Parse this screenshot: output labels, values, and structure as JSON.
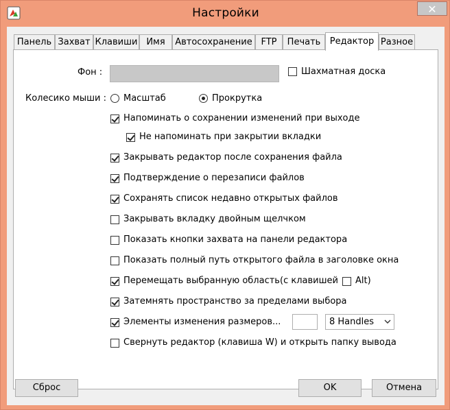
{
  "window": {
    "title": "Настройки",
    "close_glyph": "✕",
    "icon": "app-logo-icon"
  },
  "tabs": [
    {
      "label": "Панель"
    },
    {
      "label": "Захват"
    },
    {
      "label": "Клавиши"
    },
    {
      "label": "Имя"
    },
    {
      "label": "Автосохранение"
    },
    {
      "label": "FTP"
    },
    {
      "label": "Печать"
    },
    {
      "label": "Редактор",
      "active": true
    },
    {
      "label": "Разное"
    }
  ],
  "editor": {
    "background_label": "Фон :",
    "checkerboard_label": "Шахматная доска",
    "checkerboard_checked": false,
    "mouse_wheel_label": "Колесико мыши :",
    "wheel_options": [
      {
        "label": "Масштаб",
        "selected": false
      },
      {
        "label": "Прокрутка",
        "selected": true
      }
    ],
    "options": [
      {
        "label": "Напоминать о сохранении изменений при выходе",
        "checked": true
      },
      {
        "label": "Не напоминать при закрытии вкладки",
        "checked": true
      },
      {
        "label": "Закрывать редактор после сохранения файла",
        "checked": true
      },
      {
        "label": "Подтверждение о перезаписи файлов",
        "checked": true
      },
      {
        "label": "Сохранять список недавно открытых файлов",
        "checked": true
      },
      {
        "label": "Закрывать вкладку двойным щелчком",
        "checked": false
      },
      {
        "label": "Показать кнопки захвата на панели редактора",
        "checked": false
      },
      {
        "label": "Показать полный путь открытого файла в заголовке окна",
        "checked": false
      },
      {
        "label": "Перемещать выбранную область",
        "checked": true
      },
      {
        "label": "Затемнять пространство за пределами выбора",
        "checked": true
      },
      {
        "label": "Элементы изменения размеров...",
        "checked": true
      },
      {
        "label": "Свернуть редактор (клавиша W) и открыть папку вывода",
        "checked": false
      }
    ],
    "with_key_label": "(с клавишей",
    "alt_label": "Alt)",
    "alt_checked": false,
    "handles_size_value": "",
    "handles_select_value": "8 Handles"
  },
  "buttons": {
    "reset": "Сброс",
    "ok": "OK",
    "cancel": "Отмена"
  },
  "colors": {
    "titlebar": "#f19c7b",
    "panel": "#ffffff",
    "client": "#f0f0f0",
    "swatch": "#c8c8c8"
  }
}
